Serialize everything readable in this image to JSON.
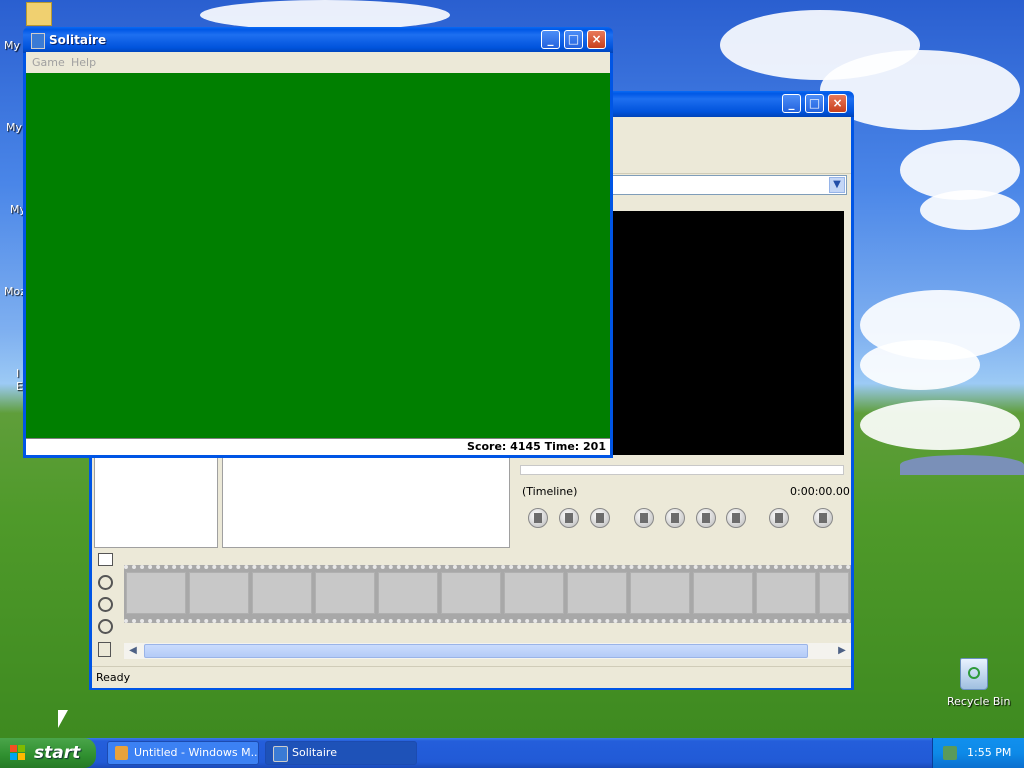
{
  "desktop": {
    "icons": [
      {
        "label": "My I"
      },
      {
        "label": "My"
      },
      {
        "label": "My"
      },
      {
        "label": "Moz"
      },
      {
        "label": "I"
      },
      {
        "label": "E"
      }
    ],
    "recycle_bin": {
      "label": "Recycle Bin"
    }
  },
  "solitaire": {
    "title": "Solitaire",
    "menu": [
      "Game",
      "Help"
    ],
    "status": "Score: 4145 Time: 201",
    "felt_color": "#007f00"
  },
  "moviemaker": {
    "timeline_label": "(Timeline)",
    "time": "0:00:00.00",
    "status": "Ready",
    "preview_color": "#000000"
  },
  "taskbar": {
    "start_label": "start",
    "tasks": [
      {
        "label": "Untitled - Windows M..."
      },
      {
        "label": "Solitaire"
      }
    ],
    "clock": "1:55 PM"
  }
}
